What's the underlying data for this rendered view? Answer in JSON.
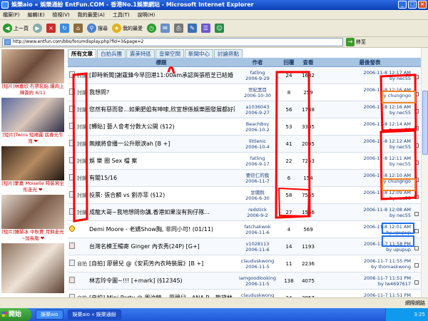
{
  "window": {
    "title": "娛樂aio « 娛樂通紛 EntFun.COM - 香港No.1娛樂網站 - Microsoft Internet Explorer"
  },
  "menu": [
    "檔案(F)",
    "編輯(E)",
    "檢視(V)",
    "我的最愛(A)",
    "工具(T)",
    "說明(H)"
  ],
  "toolbar": {
    "back": "上一頁",
    "search": "搜尋",
    "favorites": "我的最愛"
  },
  "address": {
    "url": "http://www.entfun.com/bbs/forumdisplay.php?fid=3&page=2",
    "go": "移至"
  },
  "tabs": [
    "所有文章",
    "白拍兵團",
    "震美特區",
    "音樂空間",
    "新聞中心",
    "討論熱點"
  ],
  "columns": {
    "title": "標題",
    "author": "作者",
    "replies": "回覆",
    "views": "查看",
    "last": "最後發表"
  },
  "ads": [
    {
      "caption": "[短片]林嘉欣 冇帶乳貼 爆肉上陣簽約 6/11"
    },
    {
      "caption": "[短片]Twins 短裙露 底春光乍洩 ❤"
    },
    {
      "caption": "[短片]蒙嘉 Moiselle 時裝寫全形走光 ❤"
    },
    {
      "caption": "[短片]鍾慧冰 中秋賣 月餅走光~加長版 ❤"
    }
  ],
  "threads": [
    {
      "tag": "討論",
      "title": "[即時新聞]謝霆鋒今早回港11:00am承認與張栢芝已結婚",
      "author": "fatling",
      "author_date": "2006-9-29",
      "replies": "24",
      "views": "1682",
      "last_time": "2006-11-8 12:17 AM",
      "last_by": "by nec55"
    },
    {
      "tag": "討論",
      "title": "我想問?",
      "author": "世紀黑目",
      "author_date": "2006-10-30",
      "replies": "8",
      "views": "259",
      "last_time": "2006-11-8 12:16 AM",
      "last_by": "by chungngo"
    },
    {
      "tag": "討論",
      "title": "您然有惡而發...如果肥姐有呻嗦,欣宜想係娛樂圈發展都好難 (§12)",
      "author": "a1036043",
      "author_date": "2006-9-27",
      "replies": "56",
      "views": "1738",
      "last_time": "2006-11-8 12:16 AM",
      "last_by": "by nec55"
    },
    {
      "tag": "討論",
      "title": "[轉貼] 藝人會考分數大公開 (§12)",
      "author": "BeachBoy",
      "author_date": "2006-10-2",
      "replies": "53",
      "views": "3335",
      "last_time": "2006-11-8 12:14 AM",
      "last_by": "by nec55"
    },
    {
      "tag": "討論",
      "title": "無線將會播一公升眼淚ah [B +]",
      "author": "littlenic",
      "author_date": "2006-10-4",
      "replies": "41",
      "views": "2085",
      "last_time": "2006-11-8 12:12 AM",
      "last_by": "by nec55"
    },
    {
      "tag": "討論",
      "title": "娛 樂 圈 Sex 檔 案",
      "author": "fatling",
      "author_date": "2006-9-17",
      "replies": "22",
      "views": "7253",
      "last_time": "2006-11-8 12:11 AM",
      "last_by": "by nec55"
    },
    {
      "tag": "討論",
      "title": "有關15/16",
      "author": "要信仁的我",
      "author_date": "2006-11-7",
      "replies": "6",
      "views": "154",
      "last_time": "2006-11-8 12:10 AM",
      "last_by": "by chungngo"
    },
    {
      "tag": "討論",
      "title": "投票: 張合麟 vs 劉亦菲 (§12)",
      "author": "甘國銳",
      "author_date": "2006-6-30",
      "replies": "58",
      "views": "7535",
      "last_time": "2006-11-8 12:09 AM",
      "last_by": "by nec55"
    },
    {
      "tag": "討論",
      "title": "成龍大哥~我地想問你講,香港如果沒有狗仔隊...",
      "author": "redstick",
      "author_date": "2006-9-2",
      "replies": "27",
      "views": "1566",
      "last_time": "2006-11-8 12:08 AM",
      "last_by": "by nec55"
    },
    {
      "tag": "",
      "title": "Demi Moore - 老嬌Show胸, 非同小可! (01/11)",
      "author": "fatchakwok",
      "author_date": "2006-11-6",
      "replies": "4",
      "views": "569",
      "last_time": "2006-11-8 12:01 AM",
      "last_by": "by upupup"
    },
    {
      "tag": "",
      "title": "台灣名模王暢寄 Ginger 內衣秀(24P) [G+]",
      "author": "v1028113",
      "author_date": "2006-11-6",
      "replies": "14",
      "views": "1193",
      "last_time": "2006-11-7 11:58 PM",
      "last_by": "by upupup"
    },
    {
      "tag": "自拍",
      "title": "[自拍] 廖碧兒 @《安莉芳內衣時裝展》[B +]",
      "author": "clauduskwong",
      "author_date": "2006-11-5",
      "replies": "11",
      "views": "2236",
      "last_time": "2006-11-7 11:55 PM",
      "last_by": "by thomaskwong"
    },
    {
      "tag": "",
      "title": "林志玲令圖~!!! [+mark] (§12345)",
      "author": "iamgoodlooking",
      "author_date": "2006-11-5",
      "replies": "138",
      "views": "4075",
      "last_time": "2006-11-7 11:51 PM",
      "last_by": "by lw4697617"
    },
    {
      "tag": "自拍",
      "title": "[自拍] Mini Party @ 周汶錡 、廖碧兒、ANA R、熊黛林 [B+]",
      "author": "clauduskwong",
      "author_date": "2006-11-3",
      "replies": "24",
      "views": "2957",
      "last_time": "2006-11-7 11:51 PM",
      "last_by": "by bbb123"
    }
  ],
  "status": {
    "left": "",
    "zone": "網際網路"
  },
  "taskbar": {
    "start": "開始",
    "tasks": [
      "娛樂aio",
      "娛樂aio « 娛樂通紛"
    ],
    "clock": "3:25"
  },
  "colors": {
    "annotation_red": "#ff0000",
    "annotation_orange": "#f5821f",
    "annotation_blue": "#1c6fe8"
  }
}
